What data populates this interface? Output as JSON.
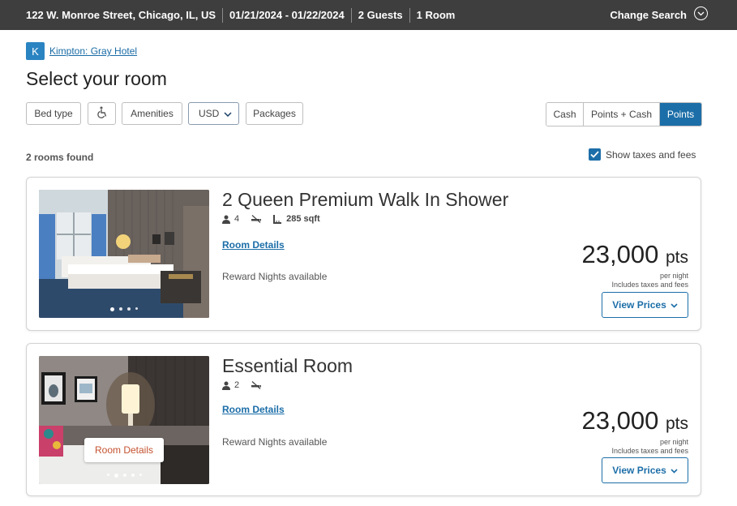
{
  "search_bar": {
    "address": "122 W. Monroe Street, Chicago, IL, US",
    "dates": "01/21/2024 - 01/22/2024",
    "guests": "2 Guests",
    "rooms": "1 Room",
    "change_label": "Change Search"
  },
  "hotel": {
    "logo_letter": "K",
    "name": "Kimpton: Gray Hotel"
  },
  "page_title": "Select your room",
  "filters": {
    "bed_type": "Bed type",
    "amenities": "Amenities",
    "currency": "USD",
    "packages": "Packages"
  },
  "rate_toggle": {
    "options": [
      "Cash",
      "Points + Cash",
      "Points"
    ],
    "selected": "Points"
  },
  "results": {
    "found": "2 rooms found",
    "taxes_label": "Show taxes and fees",
    "taxes_checked": true
  },
  "rooms": [
    {
      "name": "2 Queen Premium Walk In Shower",
      "occupancy": "4",
      "size": "285 sqft",
      "details_label": "Room Details",
      "reward": "Reward Nights available",
      "price": "23,000",
      "unit": "pts",
      "per_night": "per night",
      "includes": "Includes taxes and fees",
      "view_label": "View Prices",
      "photo_count": 4,
      "photo_active": 0
    },
    {
      "name": "Essential Room",
      "occupancy": "2",
      "details_label": "Room Details",
      "photo_button": "Room Details",
      "reward": "Reward Nights available",
      "price": "23,000",
      "unit": "pts",
      "per_night": "per night",
      "includes": "Includes taxes and fees",
      "view_label": "View Prices",
      "photo_count": 5,
      "photo_active": 1
    }
  ],
  "colors": {
    "topbar": "#3f3e3e",
    "accent": "#1c6ea8",
    "brand_logo": "#2b84c2",
    "photo_button_text": "#c4522f"
  }
}
